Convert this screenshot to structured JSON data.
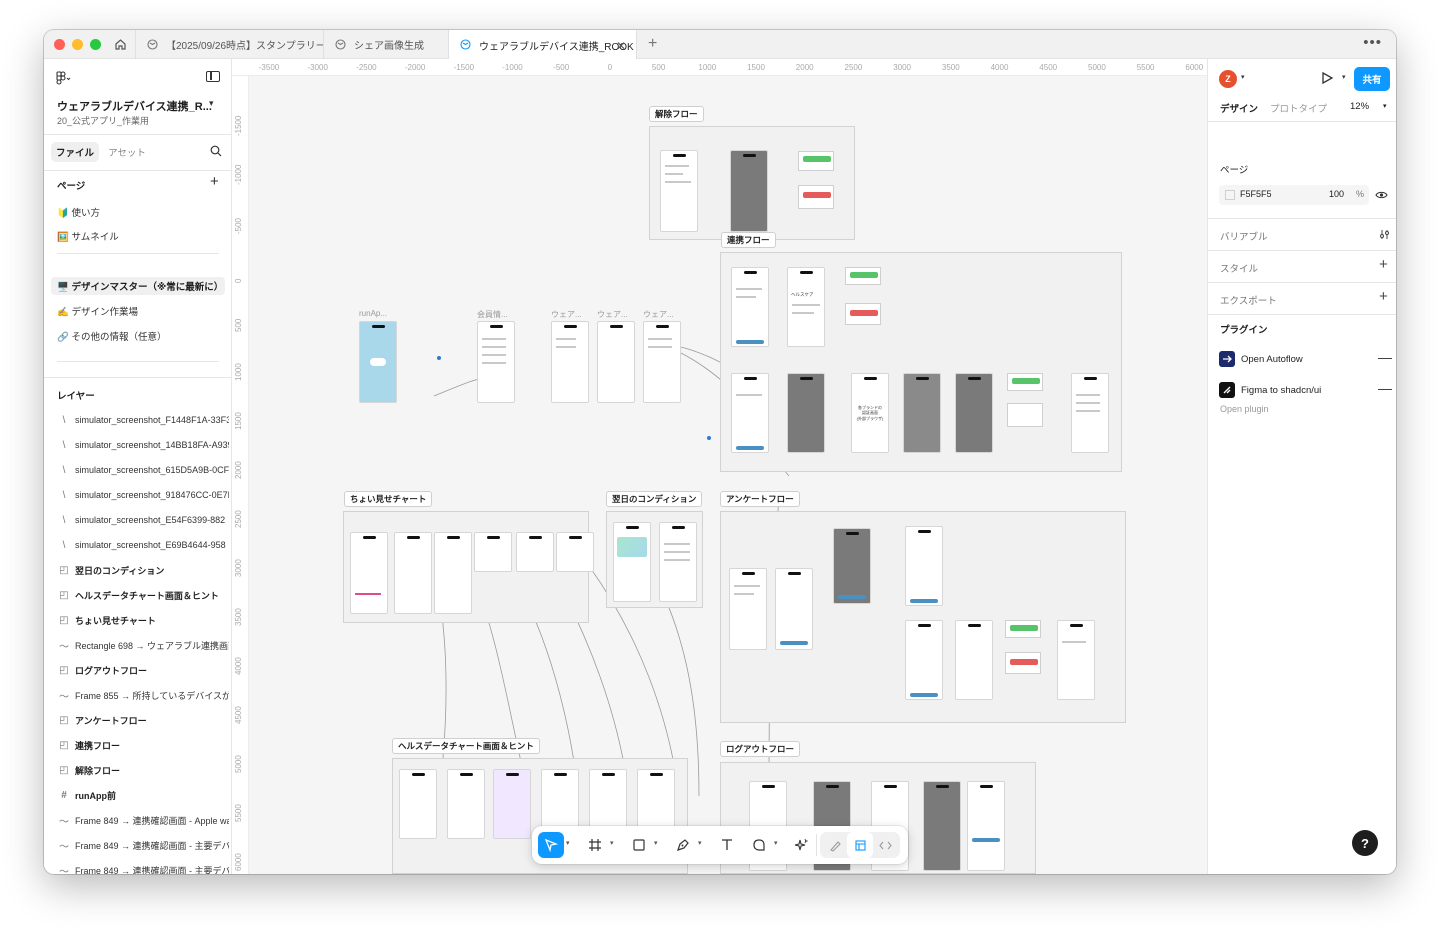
{
  "tabs": [
    {
      "label": "【2025/09/26時点】スタンプラリーイ",
      "icon": "figma-file-icon"
    },
    {
      "label": "シェア画像生成",
      "icon": "figma-file-icon"
    },
    {
      "label": "ウェアラブルデバイス連携_ROOK",
      "icon": "figma-file-icon",
      "active": true
    }
  ],
  "left_panel": {
    "file_title": "ウェアラブルデバイス連携_R...",
    "file_subtitle": "20_公式アプリ_作業用",
    "seg_files": "ファイル",
    "seg_assets": "アセット",
    "pages_label": "ページ",
    "pages": [
      {
        "label": "🔰 使い方"
      },
      {
        "label": "🖼️ サムネイル"
      },
      {
        "label": "🖥️ デザインマスター（※常に最新に）",
        "selected": true
      },
      {
        "label": "✍️ デザイン作業場"
      },
      {
        "label": "🔗 その他の情報（任意）"
      }
    ],
    "layers_label": "レイヤー",
    "layers": [
      {
        "label": "simulator_screenshot_F1448F1A-33F3",
        "type": "image"
      },
      {
        "label": "simulator_screenshot_14BB18FA-A939",
        "type": "image"
      },
      {
        "label": "simulator_screenshot_615D5A9B-0CF",
        "type": "image"
      },
      {
        "label": "simulator_screenshot_918476CC-0E7F",
        "type": "image"
      },
      {
        "label": "simulator_screenshot_E54F6399-882",
        "type": "image"
      },
      {
        "label": "simulator_screenshot_E69B4644-958",
        "type": "image"
      },
      {
        "label": "翌日のコンディション",
        "type": "section"
      },
      {
        "label": "ヘルスデータチャート画面＆ヒント",
        "type": "section"
      },
      {
        "label": "ちょい見せチャート",
        "type": "section"
      },
      {
        "label": "Rectangle 698 → ウェアラブル連携画面",
        "type": "connector"
      },
      {
        "label": "ログアウトフロー",
        "type": "section"
      },
      {
        "label": "Frame 855 → 所持しているデバイスが",
        "type": "connector"
      },
      {
        "label": "アンケートフロー",
        "type": "section"
      },
      {
        "label": "連携フロー",
        "type": "section"
      },
      {
        "label": "解除フロー",
        "type": "section"
      },
      {
        "label": "runApp前",
        "type": "frame"
      },
      {
        "label": "Frame 849 → 連携確認画面 - Apple watc",
        "type": "connector"
      },
      {
        "label": "Frame 849 → 連携確認画面 - 主要デバ",
        "type": "connector"
      },
      {
        "label": "Frame 849 → 連携確認画面 - 主要デバ",
        "type": "connector"
      }
    ]
  },
  "ruler": {
    "top": [
      "-3500",
      "-3000",
      "-2500",
      "-2000",
      "-1500",
      "-1000",
      "-500",
      "0",
      "500",
      "1000",
      "1500",
      "2000",
      "2500",
      "3000",
      "3500",
      "4000",
      "4500",
      "5000",
      "5500",
      "6000"
    ],
    "left": [
      "-1500",
      "-1000",
      "-500",
      "0",
      "500",
      "1000",
      "1500",
      "2000",
      "2500",
      "3000",
      "3500",
      "4000",
      "4500",
      "5000",
      "5500",
      "6000"
    ]
  },
  "canvas": {
    "sections": {
      "kaijo": "解除フロー",
      "renkei": "連携フロー",
      "choimise": "ちょい見せチャート",
      "yokujitsu": "翌日のコンディション",
      "survey": "アンケートフロー",
      "health": "ヘルスデータチャート画面＆ヒント",
      "logout": "ログアウトフロー"
    },
    "frame_labels": [
      "runAp...",
      "会員情...",
      "ウェア...",
      "ウェア...",
      "ウェア..."
    ],
    "brand_note": "各ブランドの\n認証画面\n(外部ブラウザ)",
    "healthcare_title": "ヘルスケア"
  },
  "right_panel": {
    "avatar_letter": "Z",
    "share_label": "共有",
    "tab_design": "デザイン",
    "tab_prototype": "プロトタイプ",
    "zoom": "12%",
    "page_label": "ページ",
    "bg_hex": "F5F5F5",
    "bg_opacity": "100",
    "bg_opacity_unit": "%",
    "variables_label": "バリアブル",
    "styles_label": "スタイル",
    "export_label": "エクスポート",
    "plugins_label": "プラグイン",
    "plugins": [
      {
        "label": "Open Autoflow"
      },
      {
        "label": "Figma to shadcn/ui"
      }
    ],
    "open_plugin": "Open plugin",
    "help": "?"
  },
  "colors": {
    "accent": "#0d99ff",
    "avatar": "#e5502e",
    "canvas_bg": "#F5F5F5"
  }
}
